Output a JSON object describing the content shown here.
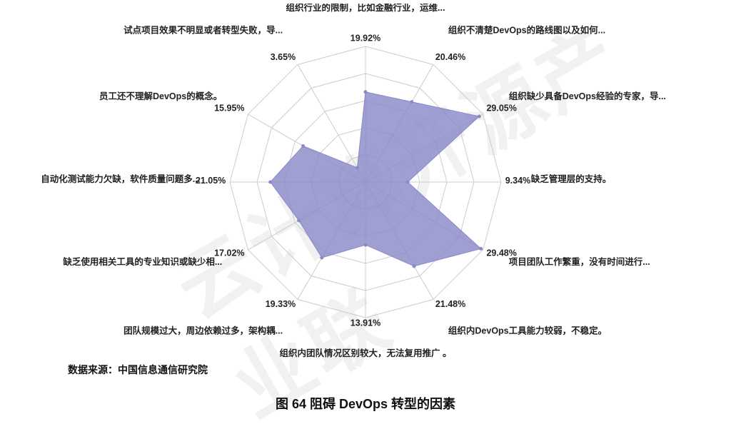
{
  "chart_data": {
    "type": "radar",
    "title": "图 64 阻碍 DevOps 转型的因素",
    "max_value": 30,
    "rings": 5,
    "categories": [
      "组织行业的限制，比如金融行业，运维...",
      "组织不清楚DevOps的路线图以及如何...",
      "组织缺少具备DevOps经验的专家，导...",
      "缺乏管理层的支持。",
      "项目团队工作繁重，没有时间进行...",
      "组织内DevOps工具能力较弱，不稳定。",
      "组织内团队情况区别较大，无法复用推广 。",
      "团队规模过大，周边依赖过多，架构耦...",
      "缺乏使用相关工具的专业知识或缺少相...",
      "自动化测试能力欠缺，软件质量问题多...",
      "员工还不理解DevOps的概念。",
      "试点项目效果不明显或者转型失败，导..."
    ],
    "values": [
      19.92,
      20.46,
      29.05,
      9.34,
      29.48,
      21.48,
      13.91,
      19.33,
      17.02,
      21.05,
      15.95,
      3.65
    ],
    "value_labels": [
      "19.92%",
      "20.46%",
      "29.05%",
      "9.34%",
      "29.48%",
      "21.48%",
      "13.91%",
      "19.33%",
      "17.02%",
      "21.05%",
      "15.95%",
      "3.65%"
    ]
  },
  "source_label": "数据来源：中国信息通信研究院",
  "watermark_text": "云计算开源产业联"
}
